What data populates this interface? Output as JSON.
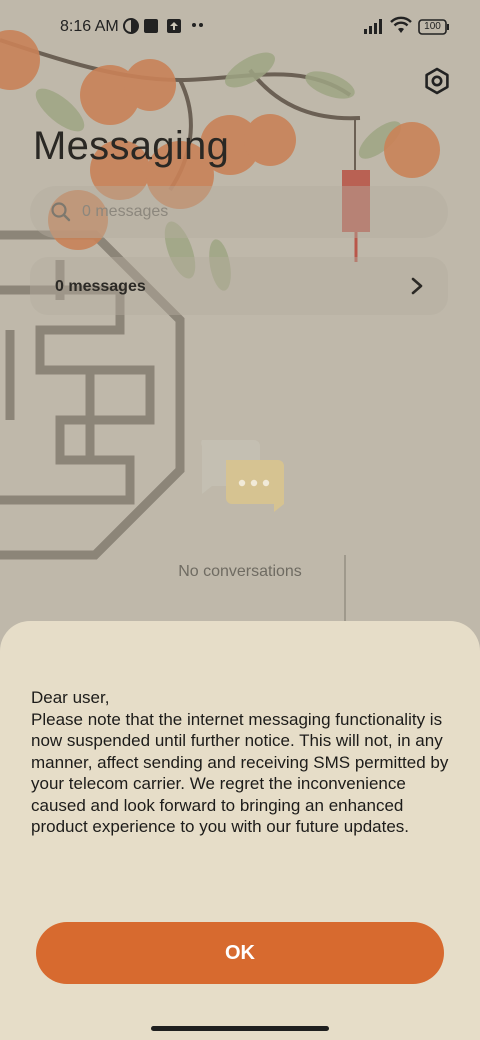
{
  "status_bar": {
    "time": "8:16 AM",
    "battery": "100",
    "left_icons": [
      "app-notification-icon",
      "square-app-icon",
      "upload-icon",
      "more-notifications-icon"
    ],
    "right_icons": [
      "signal-icon",
      "wifi-icon",
      "battery-icon"
    ]
  },
  "header": {
    "title": "Messaging",
    "settings_icon": "settings-hexagon-icon"
  },
  "search": {
    "placeholder": "0 messages",
    "icon": "search-icon"
  },
  "summary_row": {
    "label": "0 messages",
    "icon": "chevron-right-icon"
  },
  "empty_state": {
    "icon": "chat-bubbles-icon",
    "text": "No conversations"
  },
  "dialog": {
    "message": "Dear user,\nPlease note that the internet messaging functionality is now suspended until further notice. This will not, in any manner, affect sending and receiving SMS permitted by your telecom carrier. We regret the inconvenience caused and look forward to bringing an enhanced product experience to you with our future updates.",
    "ok_label": "OK"
  },
  "colors": {
    "accent": "#d76a2f",
    "sheet_background": "#e6ddc8",
    "wallpaper": "#cdc7b8"
  }
}
